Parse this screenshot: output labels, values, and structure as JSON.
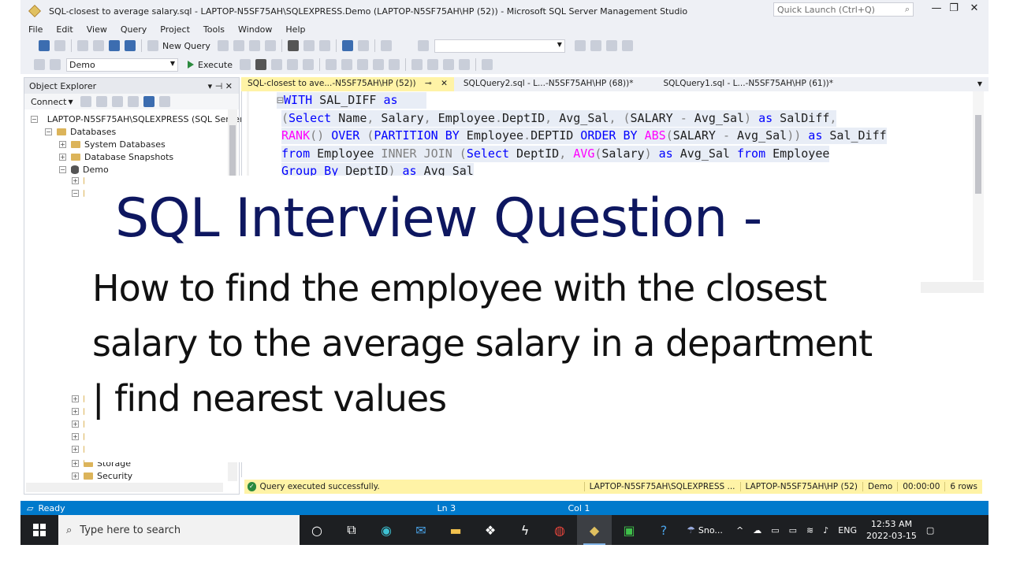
{
  "window": {
    "title": "SQL-closest to average salary.sql - LAPTOP-N5SF75AH\\SQLEXPRESS.Demo (LAPTOP-N5SF75AH\\HP (52)) - Microsoft SQL Server Management Studio",
    "quick_launch_placeholder": "Quick Launch (Ctrl+Q)"
  },
  "menu": [
    "File",
    "Edit",
    "View",
    "Query",
    "Project",
    "Tools",
    "Window",
    "Help"
  ],
  "toolbar": {
    "new_query_label": "New Query",
    "database_selected": "Demo",
    "execute_label": "Execute"
  },
  "object_explorer": {
    "title": "Object Explorer",
    "connect_label": "Connect",
    "nodes": {
      "server": "LAPTOP-N5SF75AH\\SQLEXPRESS (SQL Server",
      "databases": "Databases",
      "system_databases": "System Databases",
      "database_snapshots": "Database Snapshots",
      "demo": "Demo",
      "storage": "Storage",
      "security": "Security"
    }
  },
  "tabs": [
    {
      "label": "SQL-closest to ave...-N5SF75AH\\HP (52))",
      "active": true
    },
    {
      "label": "SQLQuery2.sql - L...-N5SF75AH\\HP (68))*",
      "active": false
    },
    {
      "label": "SQLQuery1.sql - L...-N5SF75AH\\HP (61))*",
      "active": false
    }
  ],
  "code": {
    "l1a": "WITH",
    "l1b": " SAL_DIFF ",
    "l1c": "as",
    "l2a": "(",
    "l2b": "Select",
    "l2c": " Name",
    "l2d": ",",
    "l2e": " Salary",
    "l2f": ",",
    "l2g": " Employee",
    "l2h": ".",
    "l2i": "DeptID",
    "l2j": ",",
    "l2k": " Avg_Sal",
    "l2l": ",",
    "l2m": " (",
    "l2n": "SALARY ",
    "l2o": "-",
    "l2p": " Avg_Sal",
    "l2q": ")",
    "l2r": " as",
    "l2s": " SalDiff",
    "l2t": ",",
    "l3a": "RANK",
    "l3b": "()",
    "l3c": " OVER",
    "l3d": " (",
    "l3e": "PARTITION BY",
    "l3f": " Employee",
    "l3g": ".",
    "l3h": "DEPTID",
    "l3i": " ORDER BY",
    "l3j": " ABS",
    "l3k": "(",
    "l3l": "SALARY ",
    "l3m": "-",
    "l3n": " Avg_Sal",
    "l3o": "))",
    "l3p": " as",
    "l3q": " Sal_Diff",
    "l4a": "from",
    "l4b": " Employee",
    "l4c": " INNER JOIN",
    "l4d": " (",
    "l4e": "Select",
    "l4f": " DeptID",
    "l4g": ",",
    "l4h": " AVG",
    "l4i": "(",
    "l4j": "Salary",
    "l4k": ")",
    "l4l": " as",
    "l4m": " Avg_Sal",
    "l4n": " from",
    "l4o": " Employee",
    "l5a": "Group By",
    "l5b": " DeptID",
    "l5c": ")",
    "l5d": " as",
    "l5e": " Avg_Sal"
  },
  "overlay": {
    "headline": "SQL Interview Question -",
    "line1": "How to find the employee with the closest",
    "line2": "salary to the average salary in a department",
    "line3": "| find nearest values"
  },
  "query_status": {
    "message": "Query executed successfully.",
    "server": "LAPTOP-N5SF75AH\\SQLEXPRESS ...",
    "login": "LAPTOP-N5SF75AH\\HP (52)",
    "database": "Demo",
    "elapsed": "00:00:00",
    "rows": "6 rows"
  },
  "app_status": {
    "ready": "Ready",
    "ln": "Ln 3",
    "col": "Col 1"
  },
  "taskbar": {
    "search_placeholder": "Type here to search",
    "sno_label": "Sno...",
    "lang": "ENG",
    "time": "12:53 AM",
    "date": "2022-03-15"
  }
}
